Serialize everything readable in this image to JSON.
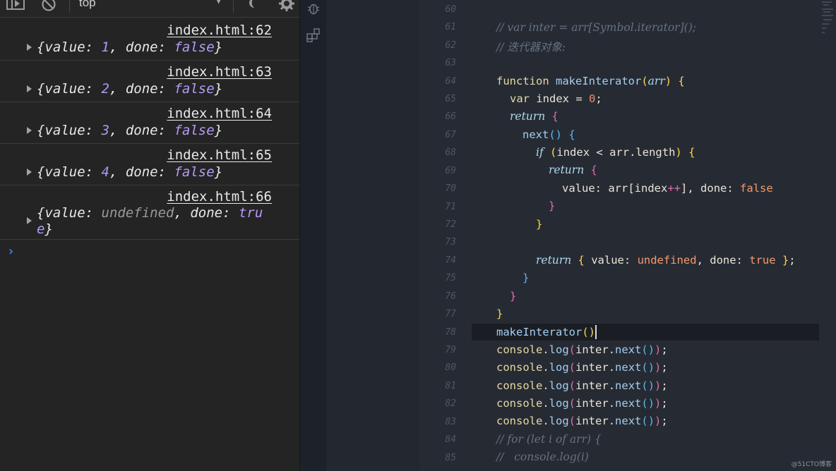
{
  "devtools": {
    "context_selector": "top",
    "entries": [
      {
        "source": "index.html:62",
        "prefix": "{value: ",
        "value": "1",
        "mid": ", done: ",
        "done": "false",
        "suffix": "}"
      },
      {
        "source": "index.html:63",
        "prefix": "{value: ",
        "value": "2",
        "mid": ", done: ",
        "done": "false",
        "suffix": "}"
      },
      {
        "source": "index.html:64",
        "prefix": "{value: ",
        "value": "3",
        "mid": ", done: ",
        "done": "false",
        "suffix": "}"
      },
      {
        "source": "index.html:65",
        "prefix": "{value: ",
        "value": "4",
        "mid": ", done: ",
        "done": "false",
        "suffix": "}"
      }
    ],
    "last_entry": {
      "source": "index.html:66",
      "prefix": "{value: ",
      "value": "undefined",
      "mid": ", done: ",
      "done_part1": "tru",
      "done_part2": "e",
      "suffix": "}"
    },
    "prompt_symbol": "›"
  },
  "editor": {
    "line_numbers": [
      "60",
      "61",
      "62",
      "63",
      "64",
      "65",
      "66",
      "67",
      "68",
      "69",
      "70",
      "71",
      "72",
      "73",
      "74",
      "75",
      "76",
      "77",
      "78",
      "79",
      "80",
      "81",
      "82",
      "83",
      "84",
      "85"
    ],
    "comment_61": "// var inter = arr[Symbol.iterator]();",
    "comment_62": "// 迭代器对象:",
    "kw_function": "function",
    "fn_make": "makeInterator",
    "param_arr": "arr",
    "kw_var": "var",
    "ident_index": "index",
    "op_eq": "=",
    "num_zero": "0",
    "semi": ";",
    "kw_return": "return",
    "fn_next": "next",
    "kw_if": "if",
    "op_lt": "<",
    "prop_length": "arr.length",
    "prop_value": "value:",
    "arr_access": "arr[index",
    "op_inc": "++",
    "close_bracket": "],",
    "prop_done": "done:",
    "lit_false": "false",
    "lit_undefined": "undefined",
    "lit_true": "true",
    "console_obj": "console",
    "console_log": "log",
    "inter_obj": "inter",
    "call_text": "console.log(inter.next());",
    "comment_84_kw": "// for (let i of arr) {",
    "comment_85": "//   console.log(i)"
  },
  "watermark": "@51CTO博客"
}
